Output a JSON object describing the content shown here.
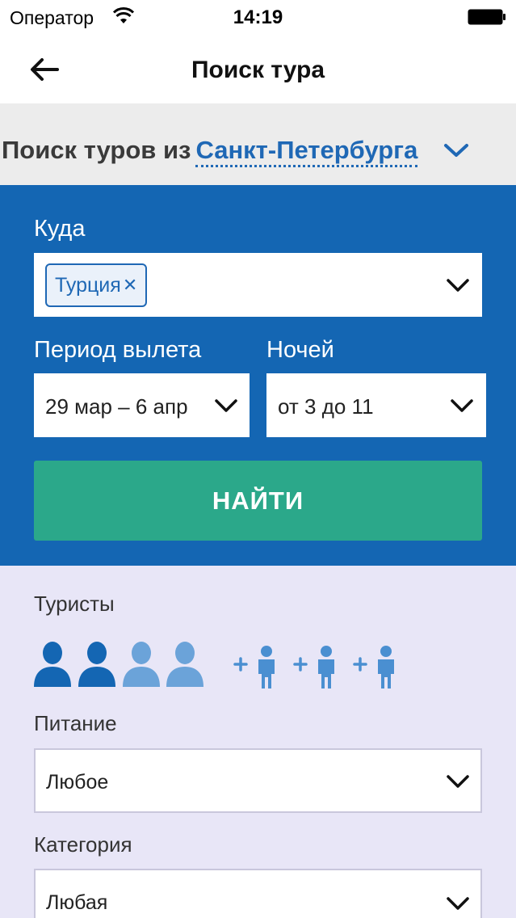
{
  "status_bar": {
    "carrier": "Оператор",
    "time": "14:19"
  },
  "nav": {
    "title": "Поиск тура",
    "back_icon": "arrow-left-icon"
  },
  "departure": {
    "prefix": "Поиск туров из",
    "city": "Санкт-Петербурга"
  },
  "search": {
    "destination_label": "Куда",
    "destination_chip": "Турция",
    "period_label": "Период вылета",
    "period_value": "29 мар – 6 апр",
    "nights_label": "Ночей",
    "nights_value": "от 3 до 11",
    "find_button": "НАЙТИ"
  },
  "params": {
    "tourists_label": "Туристы",
    "adults_selected": 2,
    "adults_max": 4,
    "children_slots": 3,
    "meal_label": "Питание",
    "meal_value": "Любое",
    "category_label": "Категория",
    "category_value": "Любая"
  },
  "colors": {
    "brand_blue": "#1466b3",
    "link_blue": "#1f68b5",
    "find_green": "#2ba88a",
    "adult_selected": "#1466b3",
    "adult_unselected": "#6ba3d9",
    "child_icon": "#4a8fd1"
  }
}
